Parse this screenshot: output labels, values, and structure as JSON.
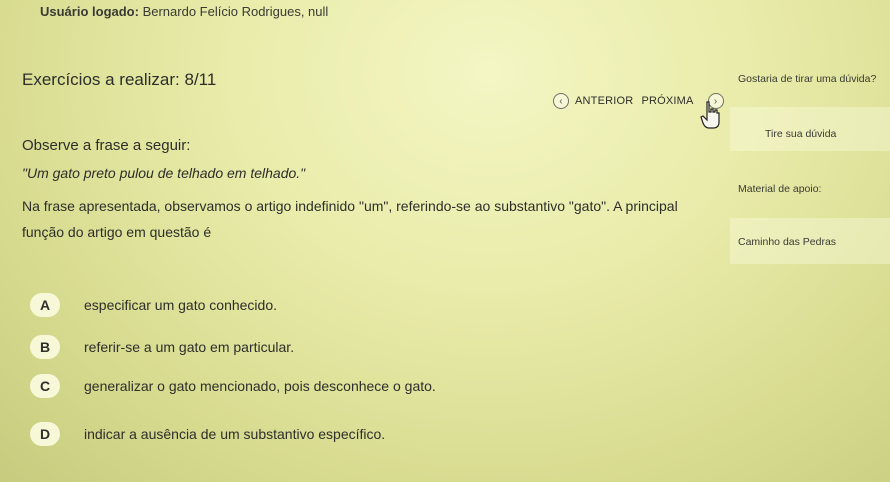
{
  "user": {
    "label": "Usuário logado:",
    "name": "Bernardo Felício Rodrigues, null"
  },
  "exercise": {
    "title": "Exercícios a realizar: 8/11"
  },
  "nav": {
    "prev_label": "ANTERIOR",
    "next_label": "PRÓXIMA"
  },
  "sidebar": {
    "question_prompt": "Gostaria de tirar uma dúvida?",
    "ask_label": "Tire sua dúvida",
    "material_label": "Material de apoio:",
    "material_item": "Caminho das Pedras"
  },
  "question": {
    "prompt": "Observe a frase a seguir:",
    "quote": "\"Um gato preto pulou de telhado em telhado.\"",
    "statement": "Na frase apresentada, observamos o artigo indefinido \"um\", referindo-se ao substantivo \"gato\". A principal função do artigo em questão é"
  },
  "options": [
    {
      "letter": "A",
      "text": "especificar um gato conhecido."
    },
    {
      "letter": "B",
      "text": "referir-se a um gato em particular."
    },
    {
      "letter": "C",
      "text": "generalizar o gato mencionado, pois desconhece o gato."
    },
    {
      "letter": "D",
      "text": "indicar a ausência de um substantivo específico."
    }
  ]
}
